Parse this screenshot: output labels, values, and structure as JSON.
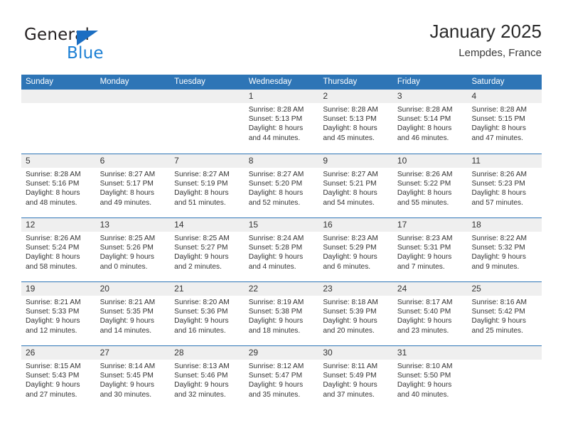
{
  "brand": {
    "name_part1": "General",
    "name_part2": "Blue",
    "accent_color": "#1b7fd4",
    "triangle_color": "#1b6ec2"
  },
  "header": {
    "title": "January 2025",
    "subtitle": "Lempdes, France"
  },
  "theme": {
    "header_bar_color": "#2e75b6",
    "day_strip_color": "#efefef",
    "text_color": "#333333"
  },
  "weekdays": [
    "Sunday",
    "Monday",
    "Tuesday",
    "Wednesday",
    "Thursday",
    "Friday",
    "Saturday"
  ],
  "weeks": [
    [
      {
        "day": "",
        "empty": true
      },
      {
        "day": "",
        "empty": true
      },
      {
        "day": "",
        "empty": true
      },
      {
        "day": "1",
        "sunrise": "Sunrise: 8:28 AM",
        "sunset": "Sunset: 5:13 PM",
        "daylight1": "Daylight: 8 hours",
        "daylight2": "and 44 minutes."
      },
      {
        "day": "2",
        "sunrise": "Sunrise: 8:28 AM",
        "sunset": "Sunset: 5:13 PM",
        "daylight1": "Daylight: 8 hours",
        "daylight2": "and 45 minutes."
      },
      {
        "day": "3",
        "sunrise": "Sunrise: 8:28 AM",
        "sunset": "Sunset: 5:14 PM",
        "daylight1": "Daylight: 8 hours",
        "daylight2": "and 46 minutes."
      },
      {
        "day": "4",
        "sunrise": "Sunrise: 8:28 AM",
        "sunset": "Sunset: 5:15 PM",
        "daylight1": "Daylight: 8 hours",
        "daylight2": "and 47 minutes."
      }
    ],
    [
      {
        "day": "5",
        "sunrise": "Sunrise: 8:28 AM",
        "sunset": "Sunset: 5:16 PM",
        "daylight1": "Daylight: 8 hours",
        "daylight2": "and 48 minutes."
      },
      {
        "day": "6",
        "sunrise": "Sunrise: 8:27 AM",
        "sunset": "Sunset: 5:17 PM",
        "daylight1": "Daylight: 8 hours",
        "daylight2": "and 49 minutes."
      },
      {
        "day": "7",
        "sunrise": "Sunrise: 8:27 AM",
        "sunset": "Sunset: 5:19 PM",
        "daylight1": "Daylight: 8 hours",
        "daylight2": "and 51 minutes."
      },
      {
        "day": "8",
        "sunrise": "Sunrise: 8:27 AM",
        "sunset": "Sunset: 5:20 PM",
        "daylight1": "Daylight: 8 hours",
        "daylight2": "and 52 minutes."
      },
      {
        "day": "9",
        "sunrise": "Sunrise: 8:27 AM",
        "sunset": "Sunset: 5:21 PM",
        "daylight1": "Daylight: 8 hours",
        "daylight2": "and 54 minutes."
      },
      {
        "day": "10",
        "sunrise": "Sunrise: 8:26 AM",
        "sunset": "Sunset: 5:22 PM",
        "daylight1": "Daylight: 8 hours",
        "daylight2": "and 55 minutes."
      },
      {
        "day": "11",
        "sunrise": "Sunrise: 8:26 AM",
        "sunset": "Sunset: 5:23 PM",
        "daylight1": "Daylight: 8 hours",
        "daylight2": "and 57 minutes."
      }
    ],
    [
      {
        "day": "12",
        "sunrise": "Sunrise: 8:26 AM",
        "sunset": "Sunset: 5:24 PM",
        "daylight1": "Daylight: 8 hours",
        "daylight2": "and 58 minutes."
      },
      {
        "day": "13",
        "sunrise": "Sunrise: 8:25 AM",
        "sunset": "Sunset: 5:26 PM",
        "daylight1": "Daylight: 9 hours",
        "daylight2": "and 0 minutes."
      },
      {
        "day": "14",
        "sunrise": "Sunrise: 8:25 AM",
        "sunset": "Sunset: 5:27 PM",
        "daylight1": "Daylight: 9 hours",
        "daylight2": "and 2 minutes."
      },
      {
        "day": "15",
        "sunrise": "Sunrise: 8:24 AM",
        "sunset": "Sunset: 5:28 PM",
        "daylight1": "Daylight: 9 hours",
        "daylight2": "and 4 minutes."
      },
      {
        "day": "16",
        "sunrise": "Sunrise: 8:23 AM",
        "sunset": "Sunset: 5:29 PM",
        "daylight1": "Daylight: 9 hours",
        "daylight2": "and 6 minutes."
      },
      {
        "day": "17",
        "sunrise": "Sunrise: 8:23 AM",
        "sunset": "Sunset: 5:31 PM",
        "daylight1": "Daylight: 9 hours",
        "daylight2": "and 7 minutes."
      },
      {
        "day": "18",
        "sunrise": "Sunrise: 8:22 AM",
        "sunset": "Sunset: 5:32 PM",
        "daylight1": "Daylight: 9 hours",
        "daylight2": "and 9 minutes."
      }
    ],
    [
      {
        "day": "19",
        "sunrise": "Sunrise: 8:21 AM",
        "sunset": "Sunset: 5:33 PM",
        "daylight1": "Daylight: 9 hours",
        "daylight2": "and 12 minutes."
      },
      {
        "day": "20",
        "sunrise": "Sunrise: 8:21 AM",
        "sunset": "Sunset: 5:35 PM",
        "daylight1": "Daylight: 9 hours",
        "daylight2": "and 14 minutes."
      },
      {
        "day": "21",
        "sunrise": "Sunrise: 8:20 AM",
        "sunset": "Sunset: 5:36 PM",
        "daylight1": "Daylight: 9 hours",
        "daylight2": "and 16 minutes."
      },
      {
        "day": "22",
        "sunrise": "Sunrise: 8:19 AM",
        "sunset": "Sunset: 5:38 PM",
        "daylight1": "Daylight: 9 hours",
        "daylight2": "and 18 minutes."
      },
      {
        "day": "23",
        "sunrise": "Sunrise: 8:18 AM",
        "sunset": "Sunset: 5:39 PM",
        "daylight1": "Daylight: 9 hours",
        "daylight2": "and 20 minutes."
      },
      {
        "day": "24",
        "sunrise": "Sunrise: 8:17 AM",
        "sunset": "Sunset: 5:40 PM",
        "daylight1": "Daylight: 9 hours",
        "daylight2": "and 23 minutes."
      },
      {
        "day": "25",
        "sunrise": "Sunrise: 8:16 AM",
        "sunset": "Sunset: 5:42 PM",
        "daylight1": "Daylight: 9 hours",
        "daylight2": "and 25 minutes."
      }
    ],
    [
      {
        "day": "26",
        "sunrise": "Sunrise: 8:15 AM",
        "sunset": "Sunset: 5:43 PM",
        "daylight1": "Daylight: 9 hours",
        "daylight2": "and 27 minutes."
      },
      {
        "day": "27",
        "sunrise": "Sunrise: 8:14 AM",
        "sunset": "Sunset: 5:45 PM",
        "daylight1": "Daylight: 9 hours",
        "daylight2": "and 30 minutes."
      },
      {
        "day": "28",
        "sunrise": "Sunrise: 8:13 AM",
        "sunset": "Sunset: 5:46 PM",
        "daylight1": "Daylight: 9 hours",
        "daylight2": "and 32 minutes."
      },
      {
        "day": "29",
        "sunrise": "Sunrise: 8:12 AM",
        "sunset": "Sunset: 5:47 PM",
        "daylight1": "Daylight: 9 hours",
        "daylight2": "and 35 minutes."
      },
      {
        "day": "30",
        "sunrise": "Sunrise: 8:11 AM",
        "sunset": "Sunset: 5:49 PM",
        "daylight1": "Daylight: 9 hours",
        "daylight2": "and 37 minutes."
      },
      {
        "day": "31",
        "sunrise": "Sunrise: 8:10 AM",
        "sunset": "Sunset: 5:50 PM",
        "daylight1": "Daylight: 9 hours",
        "daylight2": "and 40 minutes."
      },
      {
        "day": "",
        "empty": true
      }
    ]
  ]
}
